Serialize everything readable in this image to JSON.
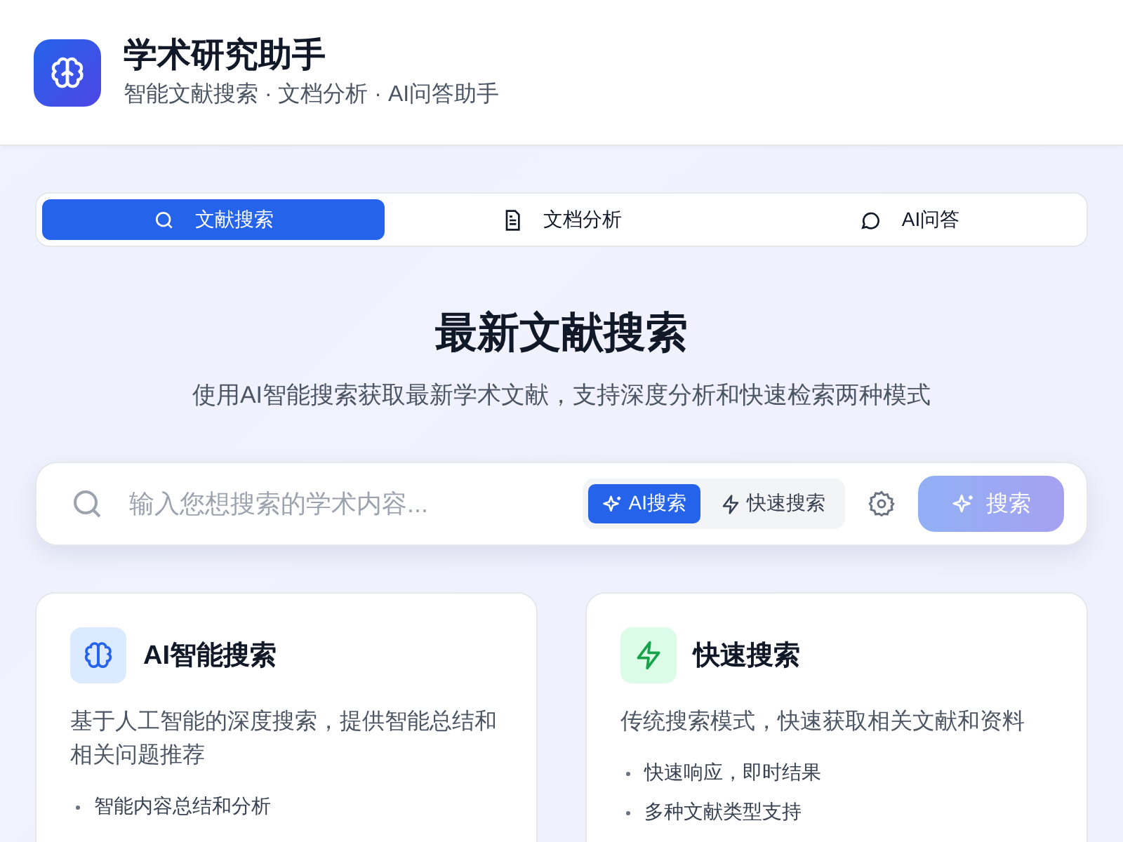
{
  "header": {
    "title": "学术研究助手",
    "subtitle": "智能文献搜索 · 文档分析 · AI问答助手"
  },
  "tabs": [
    {
      "label": "文献搜索",
      "kind": "search",
      "selected": true
    },
    {
      "label": "文档分析",
      "kind": "document",
      "selected": false
    },
    {
      "label": "AI问答",
      "kind": "chat",
      "selected": false
    }
  ],
  "hero": {
    "title": "最新文献搜索",
    "subtitle": "使用AI智能搜索获取最新学术文献，支持深度分析和快速检索两种模式"
  },
  "search": {
    "placeholder": "输入您想搜索的学术内容...",
    "modes": [
      {
        "label": "AI搜索",
        "kind": "ai",
        "selected": true
      },
      {
        "label": "快速搜索",
        "kind": "fast",
        "selected": false
      }
    ],
    "button": {
      "label": "搜索",
      "disabled": true
    }
  },
  "cards": [
    {
      "title": "AI智能搜索",
      "kind": "ai",
      "description": "基于人工智能的深度搜索，提供智能总结和相关问题推荐",
      "features": [
        "智能内容总结和分析"
      ]
    },
    {
      "title": "快速搜索",
      "kind": "fast",
      "description": "传统搜索模式，快速获取相关文献和资料",
      "features": [
        "快速响应，即时结果",
        "多种文献类型支持"
      ]
    }
  ]
}
